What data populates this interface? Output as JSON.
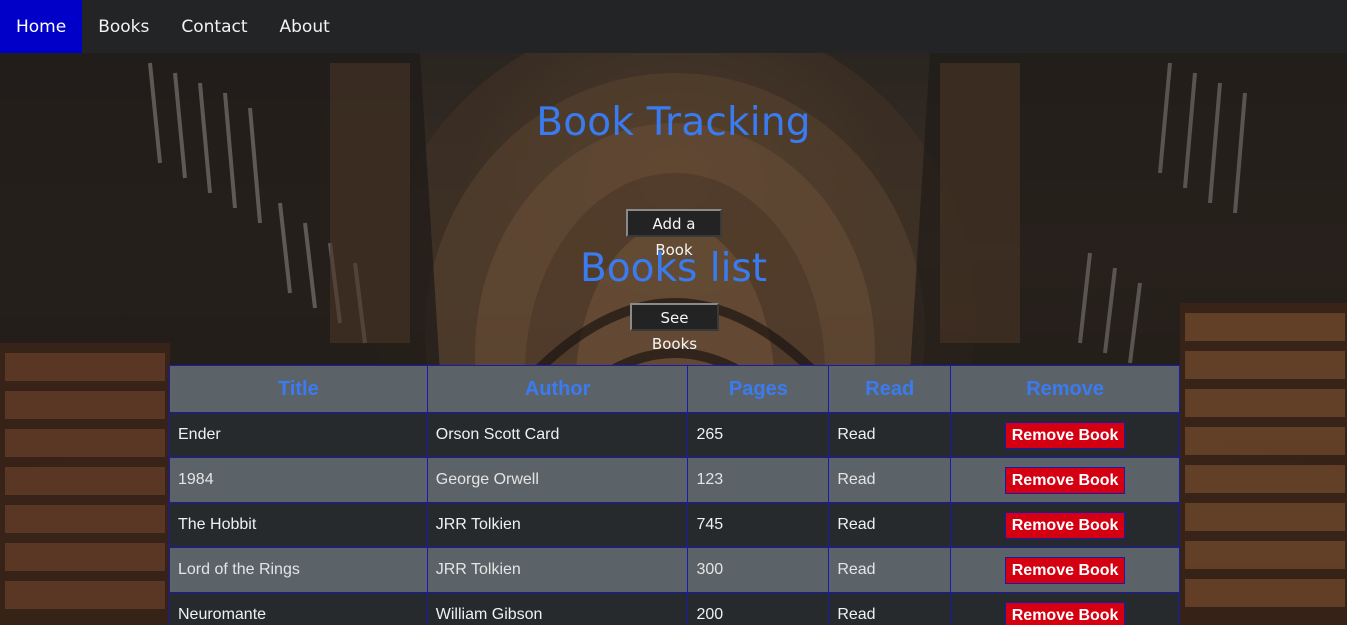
{
  "nav": {
    "items": [
      {
        "label": "Home",
        "active": true
      },
      {
        "label": "Books",
        "active": false
      },
      {
        "label": "Contact",
        "active": false
      },
      {
        "label": "About",
        "active": false
      }
    ],
    "active_color": "#0000c8"
  },
  "header": {
    "title": "Book Tracking",
    "add_button": "Add a Book"
  },
  "books_section": {
    "title": "Books list",
    "see_button": "See Books"
  },
  "table": {
    "columns": [
      "Title",
      "Author",
      "Pages",
      "Read",
      "Remove"
    ],
    "rows": [
      {
        "title": "Ender",
        "author": "Orson Scott Card",
        "pages": "265",
        "read": "Read",
        "action": "Remove Book"
      },
      {
        "title": "1984",
        "author": "George Orwell",
        "pages": "123",
        "read": "Read",
        "action": "Remove Book"
      },
      {
        "title": "The Hobbit",
        "author": "JRR Tolkien",
        "pages": "745",
        "read": "Read",
        "action": "Remove Book"
      },
      {
        "title": "Lord of the Rings",
        "author": "JRR Tolkien",
        "pages": "300",
        "read": "Read",
        "action": "Remove Book"
      },
      {
        "title": "Neuromante",
        "author": "William Gibson",
        "pages": "200",
        "read": "Read",
        "action": "Remove Book"
      }
    ]
  },
  "colors": {
    "heading": "#3b7bf0",
    "remove_button": "#d40012",
    "table_border": "#1a1ab0"
  }
}
